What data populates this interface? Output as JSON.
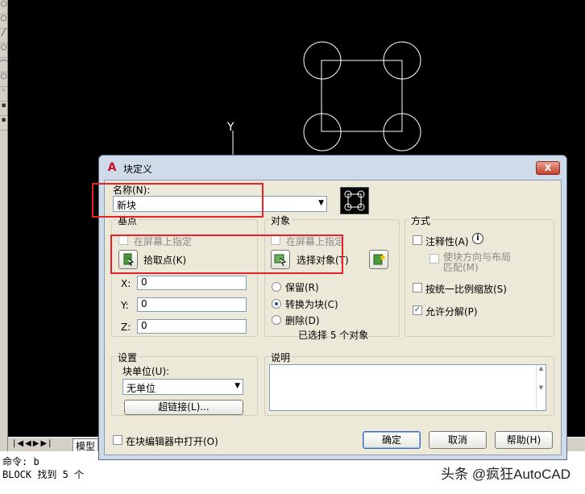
{
  "cad": {
    "y_axis_label": "Y",
    "model_tab": "模型",
    "command_line_1": "命令: b",
    "command_line_2": "BLOCK 找到 5 个"
  },
  "watermark": "头条 @疯狂AutoCAD",
  "dialog": {
    "title": "块定义",
    "close": "X",
    "name_label": "名称(N):",
    "name_value": "新块",
    "base_point": {
      "title": "基点",
      "specify_on_screen": "在屏幕上指定",
      "pick_point": "拾取点(K)",
      "x_label": "X:",
      "x_value": "0",
      "y_label": "Y:",
      "y_value": "0",
      "z_label": "Z:",
      "z_value": "0"
    },
    "objects": {
      "title": "对象",
      "specify_on_screen": "在屏幕上指定",
      "select_objects": "选择对象(T)",
      "retain": "保留(R)",
      "convert_to_block": "转换为块(C)",
      "delete": "删除(D)",
      "selected_count": "已选择 5 个对象"
    },
    "behavior": {
      "title": "方式",
      "annotative": "注释性(A)",
      "match_orientation": "使块方向与布局\n匹配(M)",
      "scale_uniformly": "按统一比例缩放(S)",
      "allow_exploding": "允许分解(P)",
      "allow_exploding_checked": true
    },
    "settings": {
      "title": "设置",
      "block_unit_label": "块单位(U):",
      "block_unit_value": "无单位",
      "hyperlink": "超链接(L)..."
    },
    "description": {
      "title": "说明"
    },
    "open_in_editor": "在块编辑器中打开(O)",
    "ok": "确定",
    "cancel": "取消",
    "help": "帮助(H)"
  }
}
